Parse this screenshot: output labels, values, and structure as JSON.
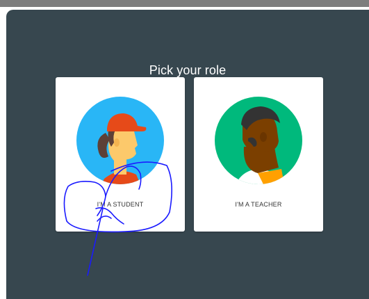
{
  "dialog": {
    "title": "Pick your role",
    "roles": [
      {
        "label": "I'M A STUDENT",
        "avatar_bg": "#29b6f6"
      },
      {
        "label": "I'M A TEACHER",
        "avatar_bg": "#00b97c"
      }
    ]
  },
  "colors": {
    "dialog_bg": "#37474f",
    "card_bg": "#ffffff",
    "annotation_ink": "#1a1aff"
  }
}
